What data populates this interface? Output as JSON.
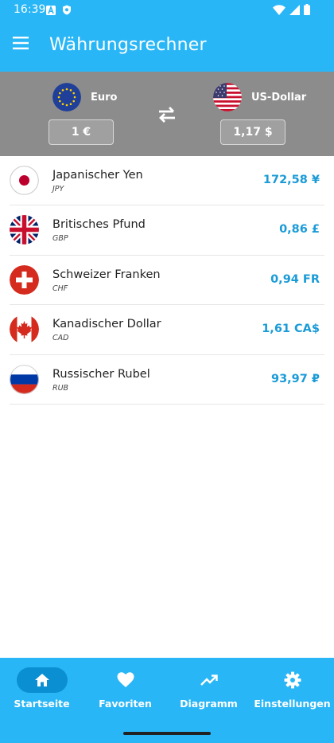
{
  "status_bar": {
    "time": "16:39"
  },
  "app_bar": {
    "title": "Währungsrechner"
  },
  "converter": {
    "from": {
      "name": "Euro",
      "amount": "1 €"
    },
    "to": {
      "name": "US-Dollar",
      "amount": "1,17 $"
    }
  },
  "currencies": [
    {
      "name": "Japanischer Yen",
      "code": "JPY",
      "value": "172,58 ¥",
      "flag": "japan-flag-icon"
    },
    {
      "name": "Britisches Pfund",
      "code": "GBP",
      "value": "0,86 £",
      "flag": "uk-flag-icon"
    },
    {
      "name": "Schweizer Franken",
      "code": "CHF",
      "value": "0,94 FR",
      "flag": "switzerland-flag-icon"
    },
    {
      "name": "Kanadischer Dollar",
      "code": "CAD",
      "value": "1,61 CA$",
      "flag": "canada-flag-icon"
    },
    {
      "name": "Russischer Rubel",
      "code": "RUB",
      "value": "93,97 ₽",
      "flag": "russia-flag-icon"
    }
  ],
  "bottom_nav": {
    "items": [
      {
        "label": "Startseite",
        "icon": "home-icon",
        "active": true
      },
      {
        "label": "Favoriten",
        "icon": "heart-icon",
        "active": false
      },
      {
        "label": "Diagramm",
        "icon": "trending-up-icon",
        "active": false
      },
      {
        "label": "Einstellungen",
        "icon": "gear-icon",
        "active": false
      }
    ]
  },
  "colors": {
    "primary": "#29b6f6",
    "accent_value": "#1a9bd7",
    "converter_bg": "#8c8c8c",
    "active_pill": "#0a8fd3"
  }
}
